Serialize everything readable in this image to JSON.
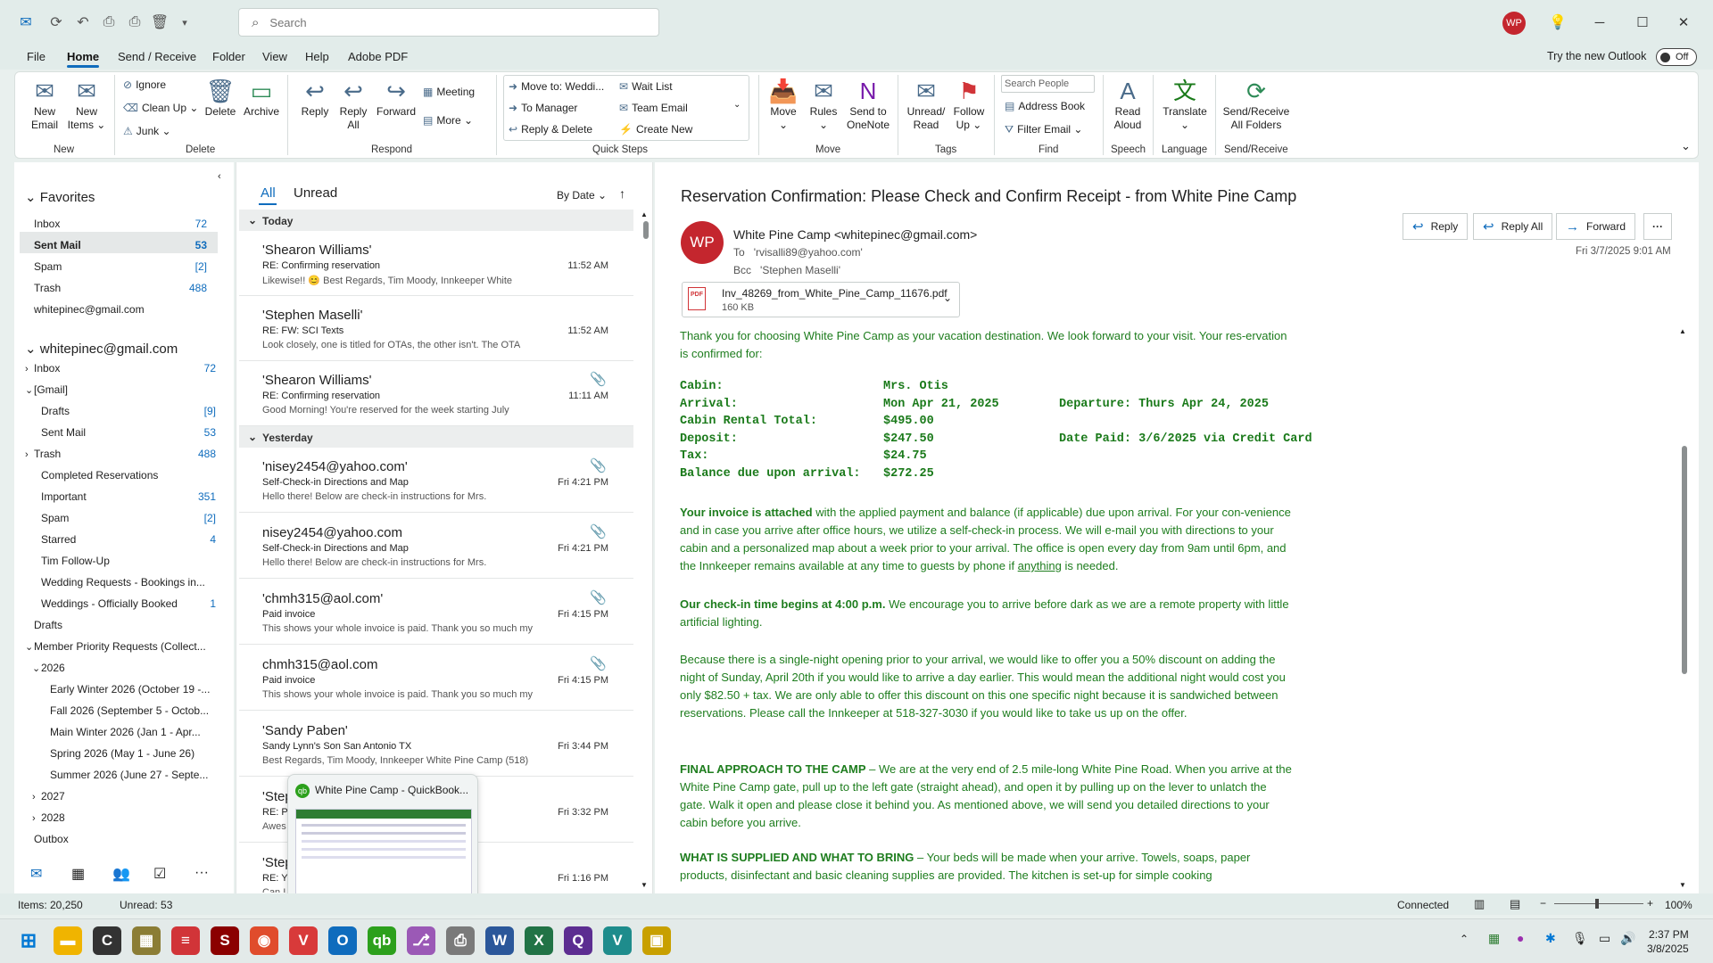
{
  "search": {
    "placeholder": "Search"
  },
  "user": {
    "initials": "WP"
  },
  "window": {
    "minimize": "─",
    "maximize": "☐",
    "close": "✕"
  },
  "menu": {
    "tabs": [
      "File",
      "Home",
      "Send / Receive",
      "Folder",
      "View",
      "Help",
      "Adobe PDF"
    ],
    "try_new": "Try the new Outlook",
    "toggle_label": "Off"
  },
  "ribbon": {
    "new_email": [
      "New",
      "Email"
    ],
    "new_items": [
      "New",
      "Items ⌄"
    ],
    "ignore": "Ignore",
    "clean_up": "Clean Up ⌄",
    "junk": "Junk ⌄",
    "delete": "Delete",
    "archive": "Archive",
    "reply": "Reply",
    "reply_all": [
      "Reply",
      "All"
    ],
    "forward": "Forward",
    "meeting": "Meeting",
    "more": "More ⌄",
    "qs_move": "Move to: Weddi...",
    "qs_manager": "To Manager",
    "qs_reply_delete": "Reply & Delete",
    "qs_wait": "Wait List",
    "qs_team": "Team Email",
    "qs_create": "Create New",
    "move": "Move",
    "rules": "Rules",
    "onenote": [
      "Send to",
      "OneNote"
    ],
    "unread": [
      "Unread/",
      "Read"
    ],
    "follow": [
      "Follow",
      "Up ⌄"
    ],
    "search_people": "Search People",
    "address_book": "Address Book",
    "filter_email": "Filter Email ⌄",
    "read_aloud": [
      "Read",
      "Aloud"
    ],
    "translate": "Translate",
    "send_receive": [
      "Send/Receive",
      "All Folders"
    ],
    "groups": {
      "new": "New",
      "delete": "Delete",
      "respond": "Respond",
      "quick_steps": "Quick Steps",
      "move": "Move",
      "tags": "Tags",
      "find": "Find",
      "speech": "Speech",
      "language": "Language",
      "send_receive": "Send/Receive"
    }
  },
  "folders": {
    "favorites": "Favorites",
    "fav_items": [
      {
        "label": "Inbox",
        "count": "72"
      },
      {
        "label": "Sent Mail",
        "count": "53"
      },
      {
        "label": "Spam",
        "count": "[2]"
      },
      {
        "label": "Trash",
        "count": "488"
      },
      {
        "label": "whitepinec@gmail.com",
        "count": ""
      }
    ],
    "account": "whitepinec@gmail.com",
    "acct_items": [
      {
        "label": "Inbox",
        "count": "72"
      },
      {
        "label": "[Gmail]",
        "count": ""
      },
      {
        "label": "Drafts",
        "count": "[9]"
      },
      {
        "label": "Sent Mail",
        "count": "53"
      },
      {
        "label": "Trash",
        "count": "488"
      },
      {
        "label": "Completed Reservations",
        "count": ""
      },
      {
        "label": "Important",
        "count": "351"
      },
      {
        "label": "Spam",
        "count": "[2]"
      },
      {
        "label": "Starred",
        "count": "4"
      },
      {
        "label": "Tim Follow-Up",
        "count": ""
      },
      {
        "label": "Wedding Requests - Bookings in...",
        "count": ""
      },
      {
        "label": "Weddings - Officially Booked",
        "count": "1"
      },
      {
        "label": "Drafts",
        "count": ""
      },
      {
        "label": "Member Priority Requests (Collect...",
        "count": ""
      },
      {
        "label": "2026",
        "count": ""
      },
      {
        "label": "Early Winter 2026 (October 19 -...",
        "count": ""
      },
      {
        "label": "Fall 2026 (September 5 - Octob...",
        "count": ""
      },
      {
        "label": "Main Winter 2026 (Jan 1 - Apr...",
        "count": ""
      },
      {
        "label": "Spring 2026 (May 1 - June 26)",
        "count": ""
      },
      {
        "label": "Summer 2026 (June 27 - Septe...",
        "count": ""
      },
      {
        "label": "2027",
        "count": ""
      },
      {
        "label": "2028",
        "count": ""
      },
      {
        "label": "Outbox",
        "count": ""
      }
    ]
  },
  "list": {
    "tab_all": "All",
    "tab_unread": "Unread",
    "sort": "By Date ⌄",
    "today": "Today",
    "yesterday": "Yesterday",
    "items": [
      {
        "sender": "'Shearon Williams'",
        "subject": "RE: Confirming reservation",
        "preview": "Likewise!! 😊 Best Regards,  Tim Moody, Innkeeper  White",
        "time": "11:52 AM",
        "attach": false
      },
      {
        "sender": "'Stephen Maselli'",
        "subject": "RE: FW: SCI Texts",
        "preview": "Look closely, one is titled for OTAs, the other isn't. The OTA",
        "time": "11:52 AM",
        "attach": false
      },
      {
        "sender": "'Shearon Williams'",
        "subject": "RE: Confirming reservation",
        "preview": "Good Morning!  You're reserved for the week starting July",
        "time": "11:11 AM",
        "attach": true
      },
      {
        "sender": "'nisey2454@yahoo.com'",
        "subject": "Self-Check-in Directions and Map",
        "preview": "Hello there!  Below are check-in instructions for Mrs.",
        "time": "Fri 4:21 PM",
        "attach": true
      },
      {
        "sender": "nisey2454@yahoo.com",
        "subject": "Self-Check-in Directions and Map",
        "preview": "Hello there!  Below are check-in instructions for Mrs.",
        "time": "Fri 4:21 PM",
        "attach": true
      },
      {
        "sender": "'chmh315@aol.com'",
        "subject": "Paid invoice",
        "preview": "This shows your whole invoice is paid. Thank you so much my",
        "time": "Fri 4:15 PM",
        "attach": true
      },
      {
        "sender": "chmh315@aol.com",
        "subject": "Paid invoice",
        "preview": "This shows your whole invoice is paid. Thank you so much my",
        "time": "Fri 4:15 PM",
        "attach": true
      },
      {
        "sender": "'Sandy Paben'",
        "subject": "Sandy Lynn's Son San Antonio TX",
        "preview": "Best Regards,  Tim Moody, Innkeeper  White Pine Camp  (518)",
        "time": "Fri 3:44 PM",
        "attach": false
      },
      {
        "sender": "'Step",
        "subject": "RE: Pl",
        "preview": "Awes                                    completely my",
        "time": "Fri 3:32 PM",
        "attach": false
      },
      {
        "sender": "'Step",
        "subject": "RE: Yo",
        "preview": "Can I                                   quick  Best",
        "time": "Fri 1:16 PM",
        "attach": false
      }
    ]
  },
  "thumbnail": {
    "title": "White Pine Camp  - QuickBook..."
  },
  "message": {
    "subject": "Reservation Confirmation: Please Check and Confirm Receipt - from White Pine Camp",
    "initials": "WP",
    "from": "White Pine Camp <whitepinec@gmail.com>",
    "to_label": "To",
    "to": "'rvisalli89@yahoo.com'",
    "bcc_label": "Bcc",
    "bcc": "'Stephen Maselli'",
    "date": "Fri 3/7/2025 9:01 AM",
    "actions": {
      "reply": "Reply",
      "reply_all": "Reply All",
      "forward": "Forward",
      "more": "···"
    },
    "attachment": {
      "name": "Inv_48269_from_White_Pine_Camp_11676.pdf",
      "size": "160 KB",
      "type": "PDF"
    },
    "intro": "Thank you for choosing White Pine Camp as your vacation destination.  We look forward to your visit.  Your res-ervation is confirmed for:",
    "details": [
      {
        "label": "Cabin:",
        "value": "Mrs. Otis",
        "extra": ""
      },
      {
        "label": "Arrival:",
        "value": "Mon Apr 21, 2025",
        "extra": "Departure: Thurs Apr 24, 2025"
      },
      {
        "label": "Cabin Rental Total:",
        "value": "$495.00",
        "extra": ""
      },
      {
        "label": "Deposit:",
        "value": "$247.50",
        "extra": "Date Paid: 3/6/2025 via Credit Card"
      },
      {
        "label": "Tax:",
        "value": "$24.75",
        "extra": ""
      },
      {
        "label": "Balance due upon arrival:",
        "value": "$272.25",
        "extra": ""
      }
    ],
    "p1_bold": "Your invoice is attached",
    "p1": " with the applied payment and balance (if applicable) due upon arrival. For your con-venience and in case you arrive after office hours, we utilize a self-check-in process. We will e-mail you with directions to your cabin and a personalized map about a week prior to your arrival. The office is open every day from 9am until 6pm, and the Innkeeper remains available at any time to guests by phone if ",
    "p1_u": "anything",
    "p1_end": " is needed.",
    "p2_bold": "Our check-in time begins at 4:00 p.m.",
    "p2": " We encourage you to arrive before dark as we are a remote property with little artificial lighting.",
    "p3": "Because there is a single-night opening prior to your arrival, we would like to offer you a 50% discount on adding the night of Sunday, April 20th if you would like to arrive a day earlier. This would mean the additional night would cost you only $82.50 + tax.   We are only able to offer this discount on this one specific night because it is sandwiched between reservations. Please call the Innkeeper at 518-327-3030 if you would like to take us up on the offer.",
    "p4_bold": "FINAL APPROACH TO THE CAMP",
    "p4": " – We are at the very end of 2.5 mile-long White Pine Road. When you arrive at the White Pine Camp gate, pull up to the left gate (straight ahead), and open it by pulling up on the lever to unlatch the gate. Walk it open and please close it behind you. As mentioned above, we will send you detailed directions to your cabin before you arrive.",
    "p5_bold": "WHAT IS SUPPLIED AND WHAT TO BRING",
    "p5": " – Your beds will be made when your arrive.  Towels, soaps, paper products, disinfectant and basic cleaning supplies are provided.  The kitchen is set-up for simple cooking"
  },
  "status": {
    "items": "Items: 20,250",
    "unread": "Unread: 53",
    "connected": "Connected",
    "zoom": "100%"
  },
  "clock": {
    "time": "2:37 PM",
    "date": "3/8/2025"
  },
  "colors": {
    "accent": "#0f6cbd",
    "avatar": "#c4262e",
    "body_text": "#1e7d1e"
  }
}
